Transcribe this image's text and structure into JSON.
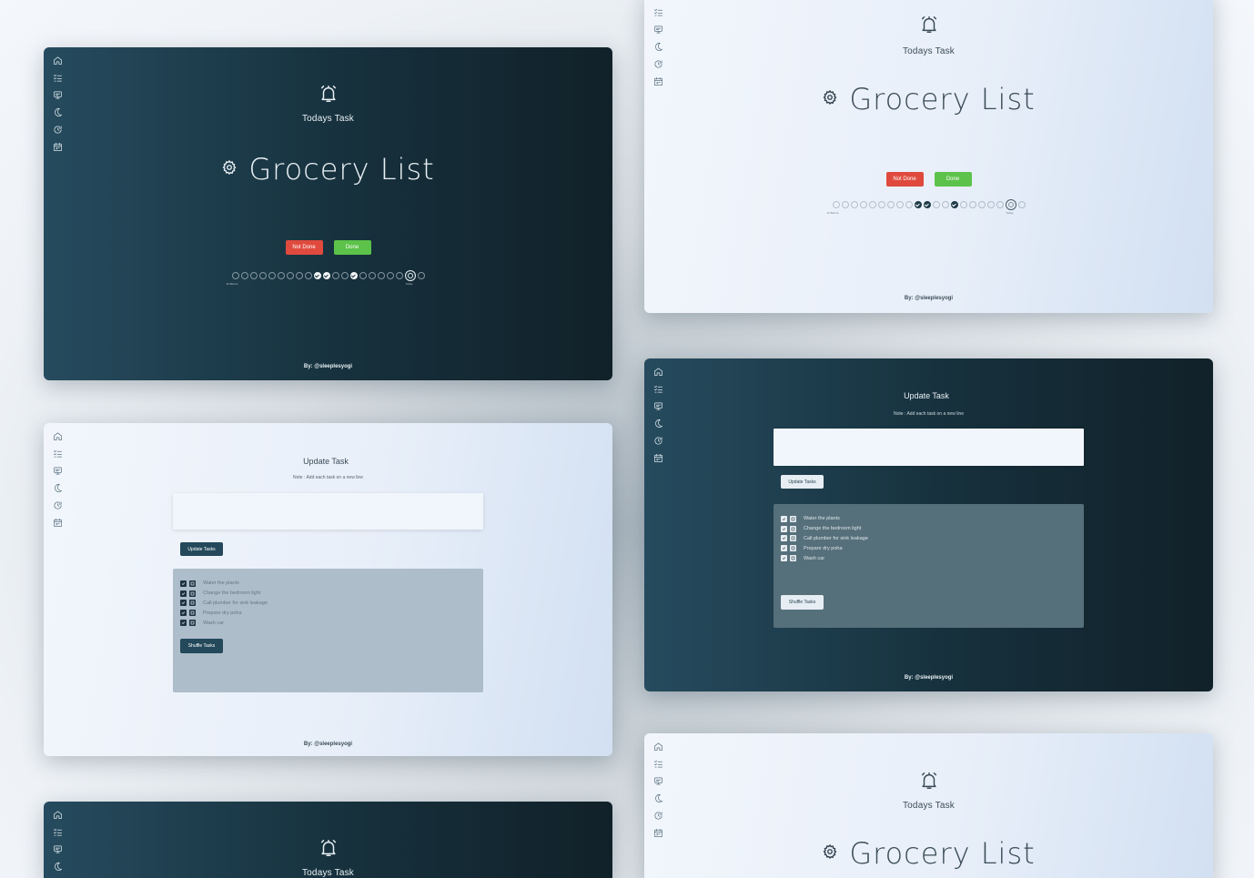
{
  "icons": [
    "home-icon",
    "checklist-icon",
    "display-icon",
    "moon-icon",
    "history-icon",
    "calendar-icon"
  ],
  "todays": {
    "label": "Todays Task",
    "task_name": "Grocery List",
    "not_done_label": "Not Done",
    "done_label": "Done",
    "start_label": "4h Before",
    "today_label": "Today",
    "progress": {
      "dark": {
        "count": 21,
        "done": [
          9,
          10,
          13
        ],
        "today": 19
      },
      "light": {
        "count": 21,
        "done": [
          9,
          10,
          13
        ],
        "today": 19
      }
    }
  },
  "update": {
    "title": "Update Task",
    "note": "Note : Add each task on a new line",
    "textarea_value": "",
    "update_button_label": "Update Tasks",
    "shuffle_button_label": "Shuffle Tasks",
    "tasks": [
      {
        "label": "Water the plants"
      },
      {
        "label": "Change the bedroom light"
      },
      {
        "label": "Call plumber for sink leakage"
      },
      {
        "label": "Prepare dry poha"
      },
      {
        "label": "Wash car"
      }
    ]
  },
  "footer": {
    "by": "By: @sleeplesyogi"
  },
  "colors": {
    "dark_bg": "#1b3644",
    "light_bg": "#e8eff9",
    "not_done": "#e04a3e",
    "done": "#5cc24a"
  }
}
